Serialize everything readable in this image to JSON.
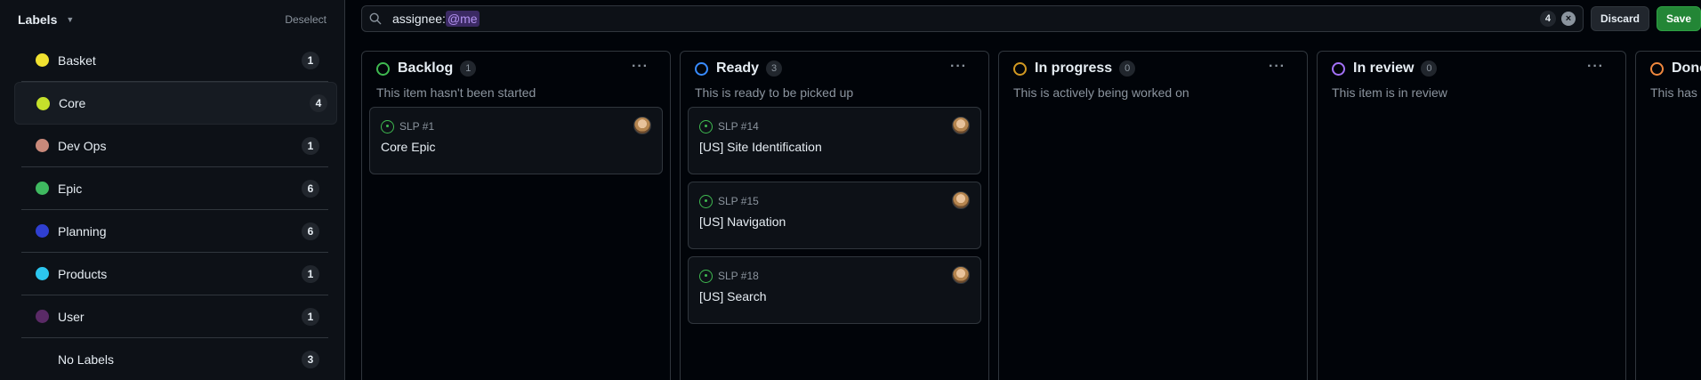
{
  "sidebar": {
    "title": "Labels",
    "deselect": "Deselect",
    "items": [
      {
        "name": "Basket",
        "count": "1",
        "color": "#f0e130"
      },
      {
        "name": "Core",
        "count": "4",
        "color": "#c5e12b",
        "active": true
      },
      {
        "name": "Dev Ops",
        "count": "1",
        "color": "#c9897a"
      },
      {
        "name": "Epic",
        "count": "6",
        "color": "#3fb960"
      },
      {
        "name": "Planning",
        "count": "6",
        "color": "#2f3fd1"
      },
      {
        "name": "Products",
        "count": "1",
        "color": "#2cc6ef"
      },
      {
        "name": "User",
        "count": "1",
        "color": "#5a2a66"
      },
      {
        "name": "No Labels",
        "count": "3",
        "color": ""
      }
    ]
  },
  "search": {
    "prefix": "assignee:",
    "token": "@me",
    "match_count": "4",
    "clear_icon": "x-circle-icon"
  },
  "toolbar": {
    "discard_label": "Discard",
    "save_label": "Save"
  },
  "columns": [
    {
      "title": "Backlog",
      "count": "1",
      "color": "#3fb950",
      "description": "This item hasn't been started",
      "cards": [
        {
          "ref": "SLP #1",
          "title": "Core Epic"
        }
      ]
    },
    {
      "title": "Ready",
      "count": "3",
      "color": "#388bfd",
      "description": "This is ready to be picked up",
      "cards": [
        {
          "ref": "SLP #14",
          "title": "[US] Site Identification"
        },
        {
          "ref": "SLP #15",
          "title": "[US] Navigation"
        },
        {
          "ref": "SLP #18",
          "title": "[US] Search"
        }
      ]
    },
    {
      "title": "In progress",
      "count": "0",
      "color": "#d29922",
      "description": "This is actively being worked on",
      "cards": []
    },
    {
      "title": "In review",
      "count": "0",
      "color": "#a371f7",
      "description": "This item is in review",
      "cards": []
    },
    {
      "title": "Done",
      "count": "",
      "color": "#f0883e",
      "description": "This has b",
      "cards": []
    }
  ],
  "more_label": "···"
}
